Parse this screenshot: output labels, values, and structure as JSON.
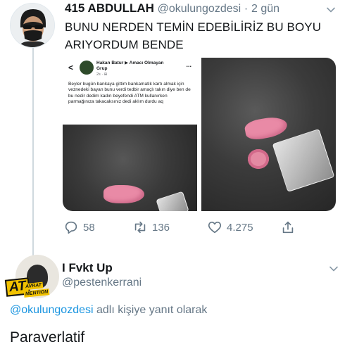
{
  "tweet": {
    "display_name": "415 ABDULLAH",
    "handle": "@okulungozdesi",
    "separator": "·",
    "time": "2 gün",
    "text": "BUNU NERDEN TEMİN EDEBİLİRİZ BU BOYU ARIYORDUM BENDE",
    "embedded_post": {
      "back": "<",
      "author": "Hakan Batur ▶ Amacı Olmayan Grup",
      "meta": "2s · ⊞",
      "more": "...",
      "body": "Beyler bugün bankaya gittim bankamatik kartı almak için veznedeki bayan bunu verdi tedbir amaçlı takın diye ben de bu nedir dedim kadın beyefendi ATM kullanırken parmağınıza takacaksınız dedi aklım durdu aq"
    },
    "actions": {
      "replies": "58",
      "retweets": "136",
      "likes": "4.275"
    }
  },
  "reply": {
    "display_name": "I Fvkt Up",
    "handle": "@pestenkerrani",
    "avatar_stamp": "AT",
    "avatar_stamp_sub_top": "AVRAT",
    "avatar_stamp_sub_bottom": "MENTION",
    "reply_to_mention": "@okulungozdesi",
    "reply_to_suffix": " adlı kişiye yanıt olarak",
    "text": "Paraverlatif"
  },
  "colors": {
    "link": "#1b95e0",
    "secondary_text": "#657786",
    "thread_line": "#cfd9de"
  }
}
